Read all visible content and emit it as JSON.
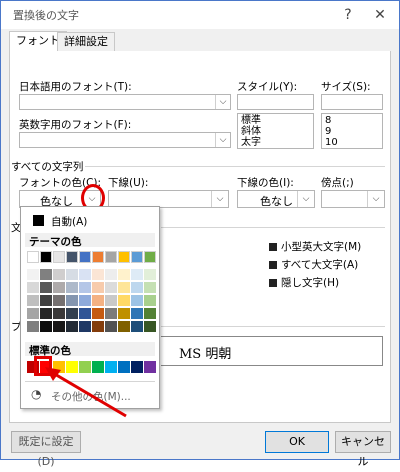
{
  "window": {
    "title": "置換後の文字",
    "help_glyph": "?",
    "close_glyph": "✕"
  },
  "tabs": [
    {
      "label": "フォント",
      "active": true
    },
    {
      "label": "詳細設定",
      "active": false
    }
  ],
  "font": {
    "jp_font_label": "日本語用のフォント(T):",
    "jp_font_value": "",
    "latin_font_label": "英数字用のフォント(F):",
    "latin_font_value": "",
    "style_label": "スタイル(Y):",
    "style_value": "",
    "style_options": [
      "標準",
      "斜体",
      "太字"
    ],
    "size_label": "サイズ(S):",
    "size_value": "",
    "size_options": [
      "8",
      "9",
      "10"
    ]
  },
  "all_text": {
    "section_label": "すべての文字列",
    "font_color_label": "フォントの色(C):",
    "font_color_value": "色なし",
    "underline_label": "下線(U):",
    "underline_value": "",
    "underline_color_label": "下線の色(I):",
    "underline_color_value": "色なし",
    "emphasis_label": "傍点(;)",
    "emphasis_value": ""
  },
  "effects": {
    "section_label_partial": "文",
    "small_caps": "小型英大文字(M)",
    "all_caps": "すべて大文字(A)",
    "hidden": "隠し文字(H)"
  },
  "preview": {
    "section_label_partial": "プ",
    "sample_text": "MS 明朝"
  },
  "color_popup": {
    "auto_label": "自動(A)",
    "theme_label": "テーマの色",
    "standard_label": "標準の色",
    "more_label": "その他の色(M)...",
    "theme_top_colors": [
      "#ffffff",
      "#000000",
      "#e7e6e6",
      "#44546a",
      "#4472c4",
      "#ed7d31",
      "#a5a5a5",
      "#ffc000",
      "#5b9bd5",
      "#70ad47"
    ],
    "theme_shades": [
      [
        "#f2f2f2",
        "#808080",
        "#d0cece",
        "#d6dce4",
        "#d9e2f3",
        "#fbe5d5",
        "#ededed",
        "#fff2cc",
        "#deebf6",
        "#e2efd9"
      ],
      [
        "#d8d8d8",
        "#595959",
        "#aeaaaa",
        "#adb9ca",
        "#b4c6e7",
        "#f7cbac",
        "#dbdbdb",
        "#fee599",
        "#bdd7ee",
        "#c5e0b3"
      ],
      [
        "#bfbfbf",
        "#404040",
        "#757070",
        "#8496b0",
        "#8eaadb",
        "#f4b183",
        "#c9c9c9",
        "#ffd965",
        "#9cc3e5",
        "#a8d08d"
      ],
      [
        "#a5a5a5",
        "#262626",
        "#3a3838",
        "#323f4f",
        "#2f5496",
        "#c55a11",
        "#7b7b7b",
        "#bf9000",
        "#2e75b5",
        "#538135"
      ],
      [
        "#7f7f7f",
        "#0d0d0d",
        "#171616",
        "#222a35",
        "#1f3864",
        "#833c0b",
        "#525252",
        "#7f6000",
        "#1e4e79",
        "#375623"
      ]
    ],
    "standard_colors": [
      "#c00000",
      "#ff0000",
      "#ffc000",
      "#ffff00",
      "#92d050",
      "#00b050",
      "#00b0f0",
      "#0070c0",
      "#002060",
      "#7030a0"
    ]
  },
  "buttons": {
    "set_default": "既定に設定(D)",
    "ok": "OK",
    "cancel": "キャンセル"
  },
  "annotations": {
    "highlight_color": "#e00000"
  }
}
